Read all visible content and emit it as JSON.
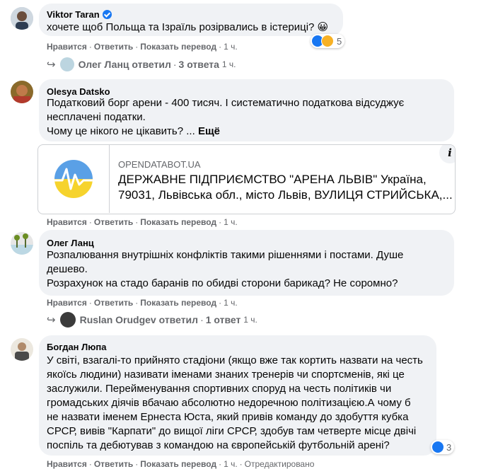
{
  "actions": {
    "like": "Нравится",
    "reply": "Ответить",
    "translate": "Показать перевод",
    "dot": "·",
    "edited": "Отредактировано"
  },
  "comments": [
    {
      "author": "Viktor Taran",
      "verified": true,
      "text": "хочете щоб Польща та Ізраїль розірвались в істериці? 😀",
      "reactions": {
        "count": "5",
        "types": [
          "like-icon",
          "haha-icon"
        ]
      },
      "time": "1 ч.",
      "replies": {
        "author": "Олег Ланц",
        "action": "ответил",
        "count": "3 ответа",
        "time": "1 ч."
      }
    },
    {
      "author": "Olesya Datsko",
      "text_lines": [
        "Податковий борг арени - 400 тисяч. І систематично податкова відсуджує",
        "несплачені податки.",
        "Чому це нікого не цікавить? ..."
      ],
      "more": "Ещё",
      "link": {
        "domain": "OPENDATABOT.UA",
        "title_lines": [
          "ДЕРЖАВНЕ ПІДПРИЄМСТВО \"АРЕНА ЛЬВІВ\" Україна,",
          "79031, Львівська обл., місто Львів, ВУЛИЦЯ СТРИЙСЬКА,..."
        ],
        "info": "i"
      },
      "time": "1 ч."
    },
    {
      "author": "Олег Ланц",
      "text_lines": [
        "Розпалювання внутрішніх конфліктів такими рішеннями і постами. Душе",
        "дешево.",
        "Розрахунок на стадо баранів по обидві сторони барикад? Не соромно?"
      ],
      "time": "1 ч.",
      "replies": {
        "author": "Ruslan Orudgev",
        "action": "ответил",
        "count": "1 ответ",
        "time": "1 ч."
      }
    },
    {
      "author": "Богдан Люпа",
      "text_lines": [
        "У світі, взагалі-то прийнято стадіони (якщо вже так кортить назвати на честь",
        "якоїсь людини) називати іменами знаних тренерів чи спортсменів, які це",
        "заслужили. Перейменування спортивних споруд на честь політиків чи",
        "громадських діячів вбачаю абсолютно недоречною політизацією.А чому б",
        "не назвати іменем Ернеста Юста, який привів команду до здобуття кубка",
        "СРСР, вивів \"Карпати\" до вищої ліги СРСР, здобув там четверте місце двічі",
        "поспіль та дебютував з командою на європейській футбольній арені?"
      ],
      "reactions": {
        "count": "3",
        "types": [
          "like-icon"
        ]
      },
      "time": "1 ч."
    }
  ],
  "colors": {
    "bubble": "#f0f2f5",
    "meta": "#65676b",
    "like": "#1877f2",
    "haha": "#f7b125"
  }
}
